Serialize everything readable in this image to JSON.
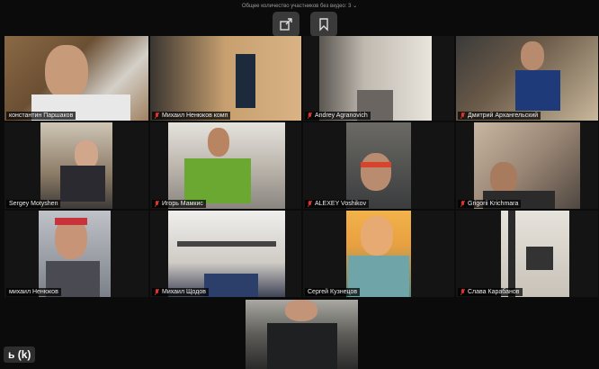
{
  "header": {
    "participants_text": "Общее количество участников без видео: 3 ⌄"
  },
  "toolbar": {
    "share_icon": "share-icon",
    "bookmark_icon": "bookmark-icon"
  },
  "participants": [
    {
      "name": "константин Паршаков",
      "muted": false
    },
    {
      "name": "Михаил Ненюков комп",
      "muted": true
    },
    {
      "name": "Andrey Agranovich",
      "muted": true
    },
    {
      "name": "Дмитрий Архангельский",
      "muted": true
    },
    {
      "name": "Sergey Motyshen",
      "muted": false
    },
    {
      "name": "Игорь Мамкис",
      "muted": true
    },
    {
      "name": "ALEXEY Voshikov",
      "muted": true
    },
    {
      "name": "Grigorii Krichmara",
      "muted": true
    },
    {
      "name": "михаил Ненюков",
      "muted": false
    },
    {
      "name": "Михаил Щодов",
      "muted": true
    },
    {
      "name": "Сергей Кузнецов",
      "muted": false
    },
    {
      "name": "Слава Карабанов",
      "muted": true
    }
  ],
  "bottom_label": "ь (k)",
  "colors": {
    "active_border": "#c9e24b",
    "muted_icon": "#e0322e"
  }
}
